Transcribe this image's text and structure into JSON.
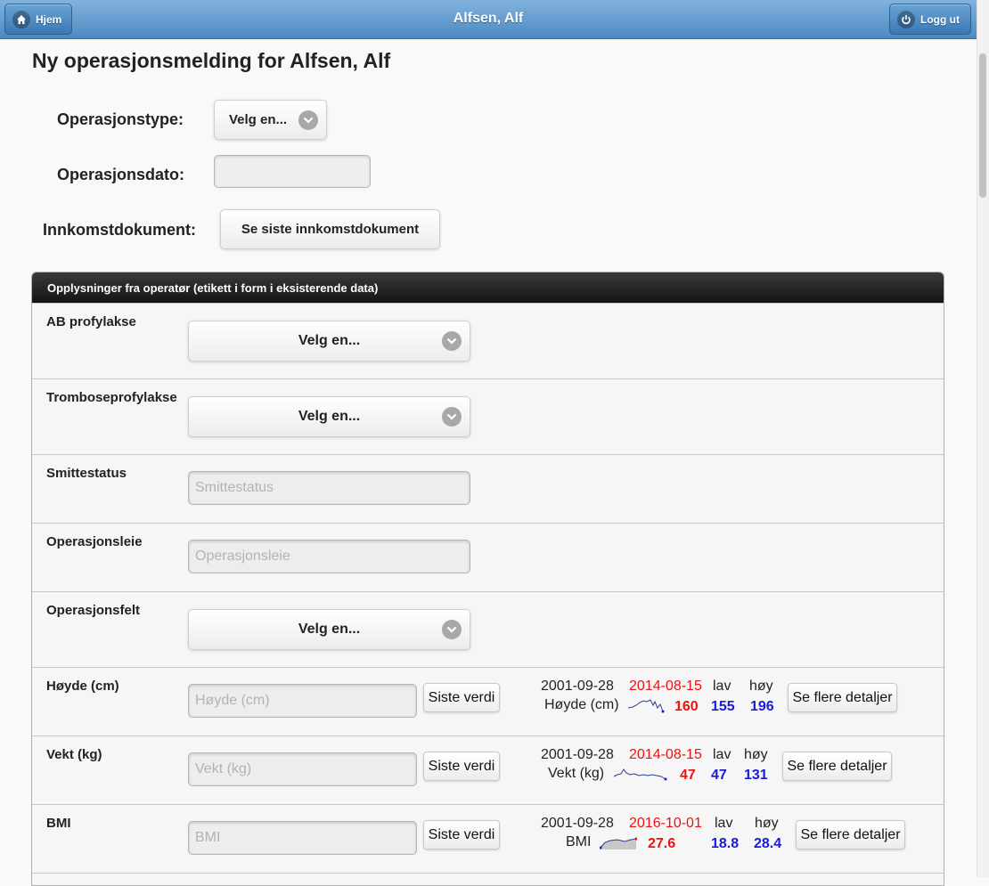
{
  "header": {
    "title": "Alfsen, Alf",
    "home_label": "Hjem",
    "logout_label": "Logg ut"
  },
  "page_title": "Ny operasjonsmelding for Alfsen, Alf",
  "form": {
    "operation_type_label": "Operasjonstype:",
    "operation_type_value": "Velg en...",
    "operation_date_label": "Operasjonsdato:",
    "operation_date_value": "",
    "income_doc_label": "Innkomstdokument:",
    "income_doc_button": "Se siste innkomstdokument"
  },
  "panel": {
    "title": "Opplysninger fra operatør (etikett i form i eksisterende data)",
    "rows": [
      {
        "label": "AB profylakse",
        "value": "Velg en..."
      },
      {
        "label": "Tromboseprofylakse",
        "value": "Velg en..."
      },
      {
        "label": "Smittestatus",
        "placeholder": "Smittestatus"
      },
      {
        "label": "Operasjonsleie",
        "placeholder": "Operasjonsleie"
      },
      {
        "label": "Operasjonsfelt",
        "value": "Velg en..."
      },
      {
        "label": "Høyde (cm)",
        "placeholder": "Høyde (cm)",
        "last_button": "Siste verdi",
        "first_date": "2001-09-28",
        "last_date": "2014-08-15",
        "low_label": "lav",
        "high_label": "høy",
        "name": "Høyde (cm)",
        "last_value": "160",
        "low_value": "155",
        "high_value": "196",
        "details_button": "Se flere detaljer"
      },
      {
        "label": "Vekt (kg)",
        "placeholder": "Vekt (kg)",
        "last_button": "Siste verdi",
        "first_date": "2001-09-28",
        "last_date": "2014-08-15",
        "low_label": "lav",
        "high_label": "høy",
        "name": "Vekt (kg)",
        "last_value": "47",
        "low_value": "47",
        "high_value": "131",
        "details_button": "Se flere detaljer"
      },
      {
        "label": "BMI",
        "placeholder": "BMI",
        "last_button": "Siste verdi",
        "first_date": "2001-09-28",
        "last_date": "2016-10-01",
        "low_label": "lav",
        "high_label": "høy",
        "name": "BMI",
        "last_value": "27.6",
        "low_value": "18.8",
        "high_value": "28.4",
        "details_button": "Se flere detaljer"
      }
    ]
  },
  "colors": {
    "header": "#5b95cb",
    "panel_header": "#1f1f1f",
    "last_date": "#e11111",
    "last_value": "#e11111",
    "range_value": "#1a1ad8"
  }
}
